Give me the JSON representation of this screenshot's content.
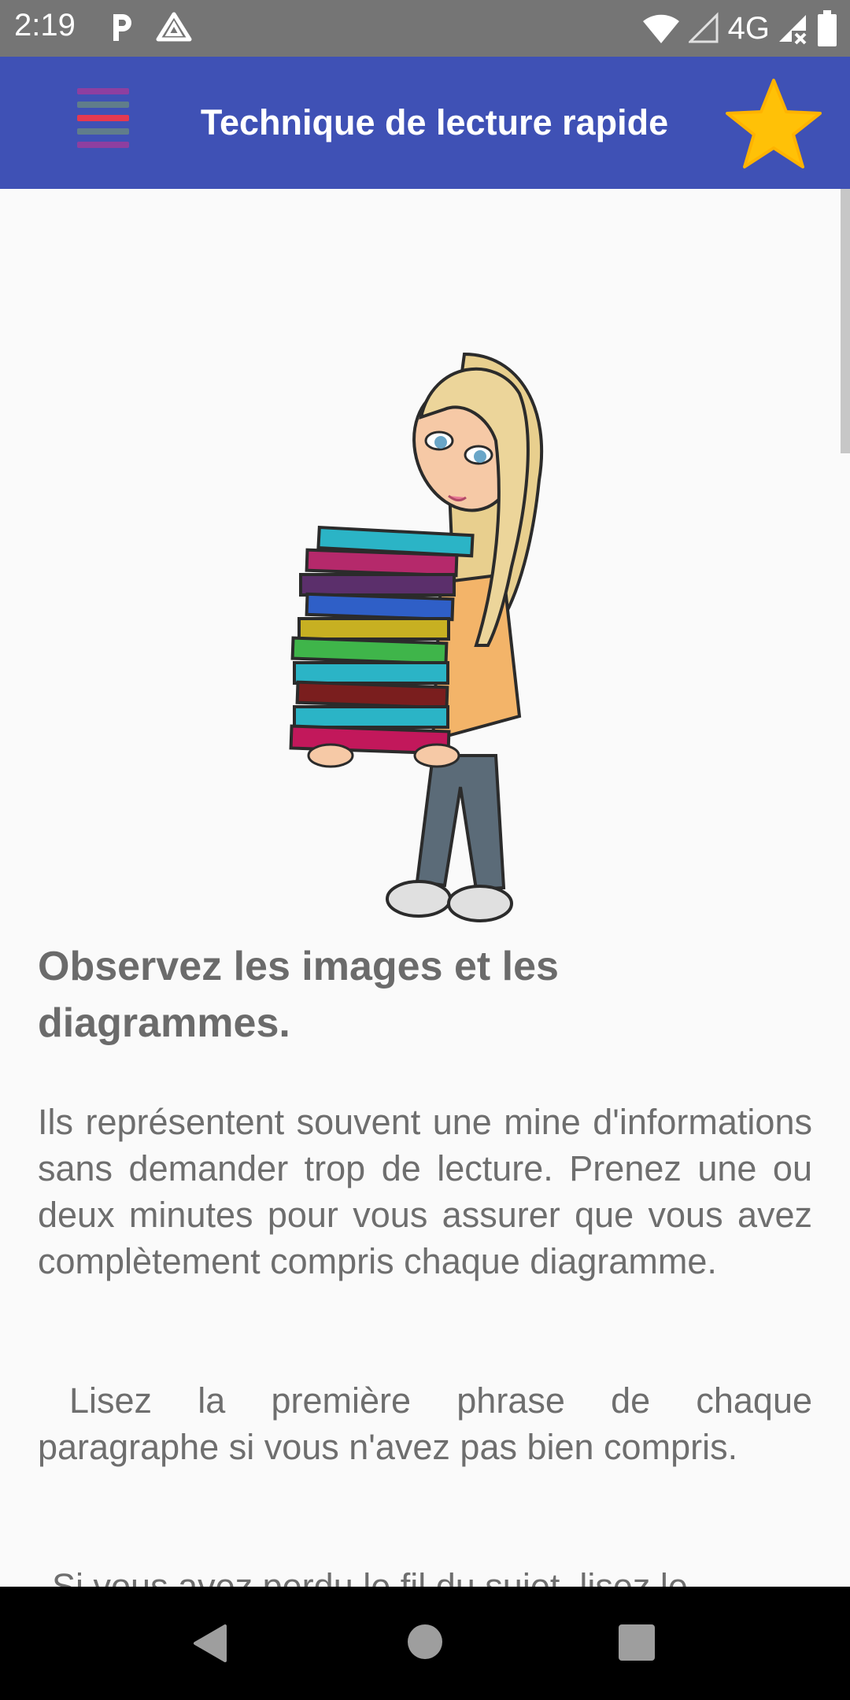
{
  "status_bar": {
    "time": "2:19",
    "network": "4G",
    "icons": [
      "parking-icon",
      "drive-icon",
      "wifi-icon",
      "signal-empty-icon",
      "signal-x-icon",
      "battery-icon"
    ]
  },
  "app_bar": {
    "title": "Technique de lecture rapide",
    "menu_icon": "menu-icon",
    "star_icon": "star-icon",
    "colors": {
      "background": "#3f51b5",
      "star": "#ffc107"
    }
  },
  "content": {
    "heading": "Observez les images et les diagrammes.",
    "paragraphs": [
      "Ils représentent souvent une mine d'informations sans demander trop de lecture. Prenez une ou deux minutes pour vous assurer que vous avez complètement compris chaque diagramme.",
      "Lisez la première phrase de chaque paragraphe si vous n'avez pas bien compris.",
      "Si vous avez perdu le fil du sujet, lisez le"
    ]
  },
  "nav_bar": {
    "icons": [
      "back-icon",
      "home-icon",
      "recents-icon"
    ]
  }
}
